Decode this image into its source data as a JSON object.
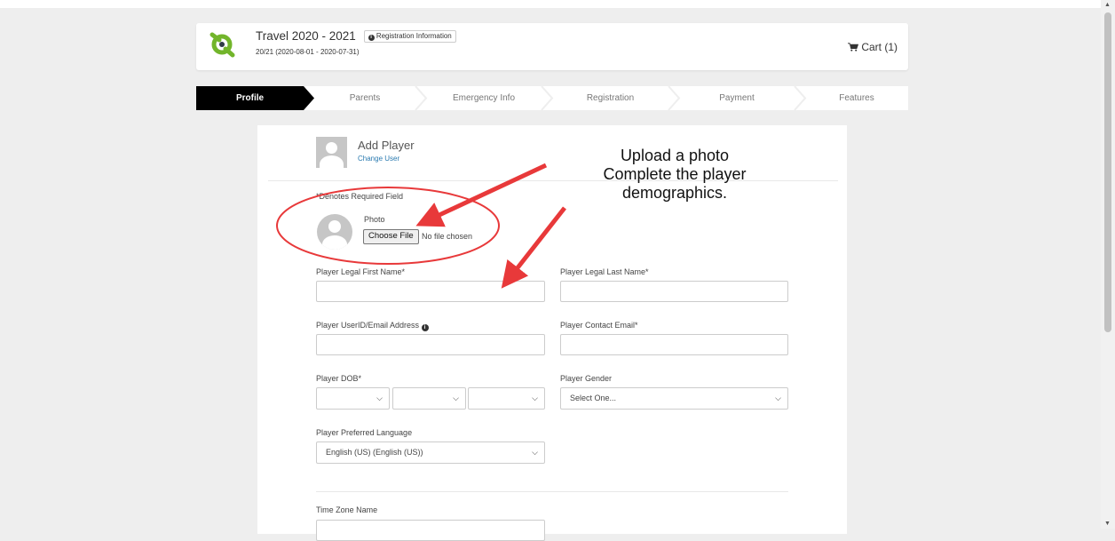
{
  "header": {
    "title": "Travel 2020 - 2021",
    "reg_info_label": "Registration Information",
    "season": "20/21 (2020-08-01 - 2020-07-31)",
    "cart_label": "Cart (1)"
  },
  "steps": [
    {
      "label": "Profile"
    },
    {
      "label": "Parents"
    },
    {
      "label": "Emergency Info"
    },
    {
      "label": "Registration"
    },
    {
      "label": "Payment"
    },
    {
      "label": "Features"
    }
  ],
  "profile": {
    "title": "Add Player",
    "change_user": "Change User",
    "required_note": "*Denotes Required Field",
    "photo_label": "Photo",
    "choose_file": "Choose File",
    "no_file": "No file chosen"
  },
  "form": {
    "first_name_label": "Player Legal First Name*",
    "last_name_label": "Player Legal Last Name*",
    "userid_label": "Player UserID/Email Address",
    "contact_email_label": "Player Contact Email*",
    "dob_label": "Player DOB*",
    "gender_label": "Player Gender",
    "gender_value": "Select One...",
    "language_label": "Player Preferred Language",
    "language_value": "English (US) (English (US))",
    "timezone_label": "Time Zone Name"
  },
  "annotation": {
    "line1": "Upload a photo",
    "line2": "Complete the player",
    "line3": "demographics."
  },
  "colors": {
    "accent_green": "#72b52b",
    "step_active": "#000000",
    "arrow_red": "#e8393a",
    "link_blue": "#2a7ab0"
  }
}
